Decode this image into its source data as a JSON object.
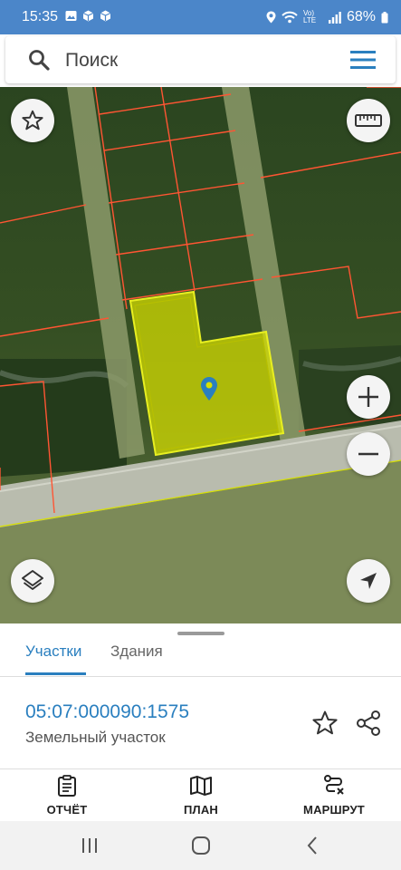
{
  "status_bar": {
    "time": "15:35",
    "network": "Vo) LTE",
    "battery": "68%"
  },
  "search": {
    "placeholder": "Поиск",
    "search_icon": "search-icon",
    "menu_icon": "menu-icon"
  },
  "map": {
    "controls": {
      "favorite_icon": "star-icon",
      "ruler_icon": "ruler-icon",
      "zoom_in_icon": "plus-icon",
      "zoom_out_icon": "minus-icon",
      "layers_icon": "layers-icon",
      "location_icon": "navigation-arrow-icon"
    },
    "marker_icon": "location-pin-icon",
    "highlight_color": "#d8e000",
    "boundary_color": "#ff5533",
    "marker_color": "#2a7fbf"
  },
  "sheet": {
    "tabs": [
      {
        "label": "Участки",
        "active": true
      },
      {
        "label": "Здания",
        "active": false
      }
    ],
    "parcel": {
      "cadastral_number": "05:07:000090:1575",
      "type": "Земельный участок",
      "star_icon": "star-icon",
      "share_icon": "share-icon"
    },
    "bottom_actions": [
      {
        "label": "ОТЧЁТ",
        "icon": "clipboard-icon"
      },
      {
        "label": "ПЛАН",
        "icon": "map-icon"
      },
      {
        "label": "МАРШРУТ",
        "icon": "route-icon"
      }
    ]
  },
  "colors": {
    "accent": "#2a7fbf",
    "status_bar": "#4b86c9"
  },
  "navigation_bar": {
    "icons": [
      "recent-apps-icon",
      "home-icon",
      "back-icon"
    ]
  }
}
